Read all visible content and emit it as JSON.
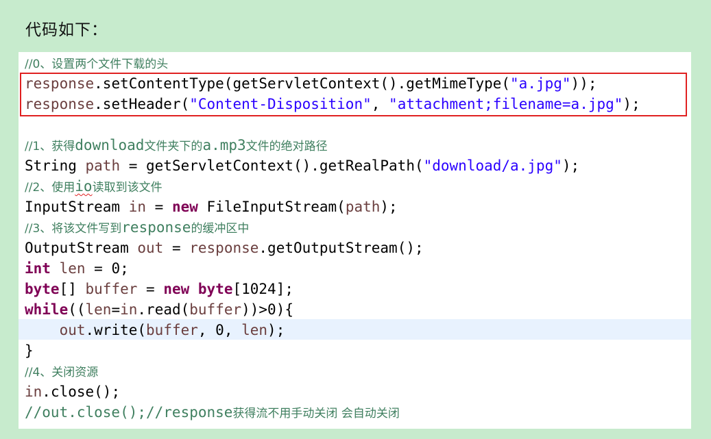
{
  "heading": "代码如下：",
  "code": {
    "l0_comment": "//0、设置两个文件下载的头",
    "l1": {
      "obj": "response",
      "call": ".setContentType(getServletContext().getMimeType(",
      "str": "\"a.jpg\"",
      "end": "));"
    },
    "l2": {
      "obj": "response",
      "call": ".setHeader(",
      "str1": "\"Content-Disposition\"",
      "sep": ", ",
      "str2": "\"attachment;filename=a.jpg\"",
      "end": ");"
    },
    "l3_comment_a": "//1、获得",
    "l3_comment_b": "download",
    "l3_comment_c": "文件夹下的",
    "l3_comment_d": "a.mp3",
    "l3_comment_e": "文件的绝对路径",
    "l4": {
      "type": "String ",
      "var": "path",
      "mid": " = getServletContext().getRealPath(",
      "str": "\"download/a.jpg\"",
      "end": ");"
    },
    "l5_comment_a": "//2、使用",
    "l5_comment_b": "io",
    "l5_comment_c": "读取到该文件",
    "l6": {
      "type": "InputStream ",
      "var": "in",
      "eq": " = ",
      "kw": "new",
      "rest": " FileInputStream(",
      "arg": "path",
      "end": ");"
    },
    "l7_comment_a": "//3、将该文件写到",
    "l7_comment_b": "response",
    "l7_comment_c": "的缓冲区中",
    "l8": {
      "type": "OutputStream ",
      "var": "out",
      "eq": " = ",
      "obj": "response",
      "end": ".getOutputStream();"
    },
    "l9": {
      "kw": "int",
      "sp": " ",
      "var": "len",
      "end": " = 0;"
    },
    "l10": {
      "kw": "byte",
      "br": "[] ",
      "var": "buffer",
      "eq": " = ",
      "kw2": "new",
      "sp": " ",
      "kw3": "byte",
      "end": "[1024];"
    },
    "l11": {
      "kw": "while",
      "open": "((",
      "var1": "len",
      "eq": "=",
      "var2": "in",
      "mid": ".read(",
      "var3": "buffer",
      "end": "))>0){"
    },
    "l12": {
      "indent": "    ",
      "var1": "out",
      "mid": ".write(",
      "var2": "buffer",
      "sep": ", 0, ",
      "var3": "len",
      "end": ");"
    },
    "l13": "}",
    "l14_comment": "//4、关闭资源",
    "l15": {
      "var": "in",
      "end": ".close();"
    },
    "l16_comment_a": "//out.close();//response",
    "l16_comment_b": "获得流不用手动关闭 会自动关闭"
  }
}
